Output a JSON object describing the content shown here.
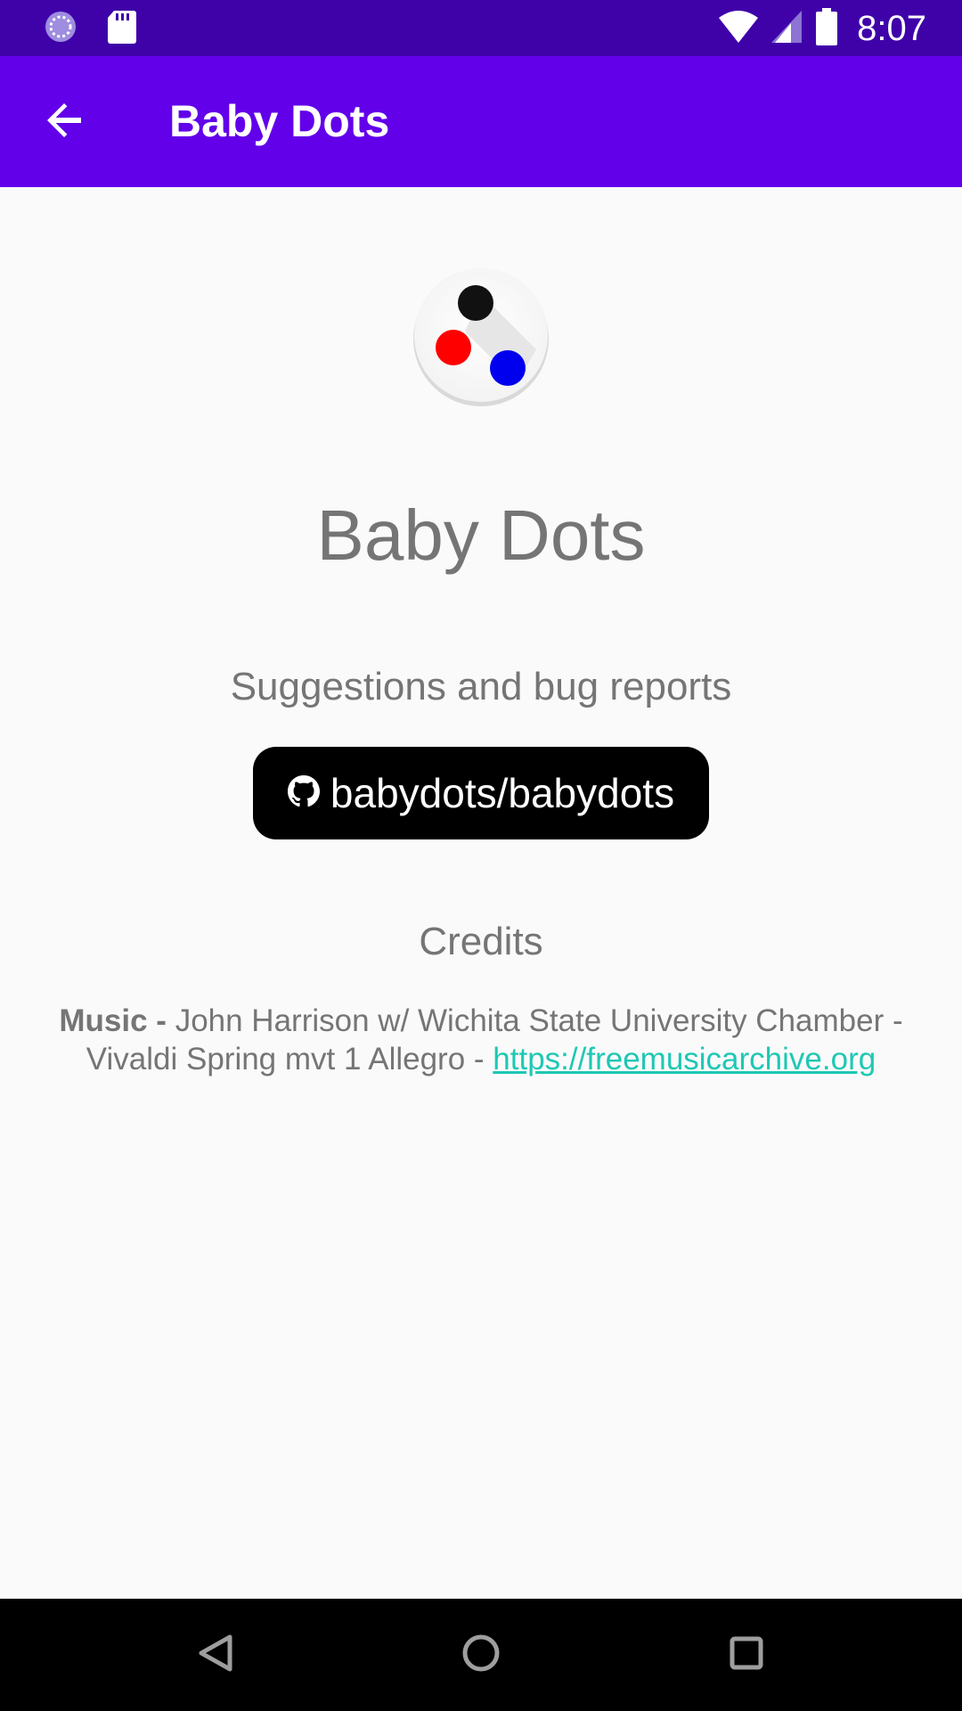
{
  "status_bar": {
    "time": "8:07",
    "icons": [
      "loading-icon",
      "sd-card-icon",
      "wifi-icon",
      "cell-signal-icon",
      "battery-icon"
    ]
  },
  "app_bar": {
    "title": "Baby Dots",
    "back_icon": "arrow-back-icon"
  },
  "main": {
    "app_name": "Baby Dots",
    "suggestions_label": "Suggestions and bug reports",
    "github_button": {
      "label": "babydots/babydots",
      "icon": "github-icon"
    },
    "credits_title": "Credits",
    "credits": {
      "music_label": "Music -",
      "music_text": "John Harrison w/ Wichita State University Chamber - Vivaldi Spring mvt 1 Allegro -",
      "link": "https://freemusicarchive.org"
    }
  },
  "nav_bar": {
    "icons": [
      "back-triangle-icon",
      "home-circle-icon",
      "recents-square-icon"
    ]
  },
  "colors": {
    "status_bar": "#3f02a9",
    "app_bar": "#6200ea",
    "link": "#1ec8b4",
    "text_gray": "#757575",
    "dot_black": "#111111",
    "dot_red": "#ff0000",
    "dot_blue": "#0000ee"
  }
}
